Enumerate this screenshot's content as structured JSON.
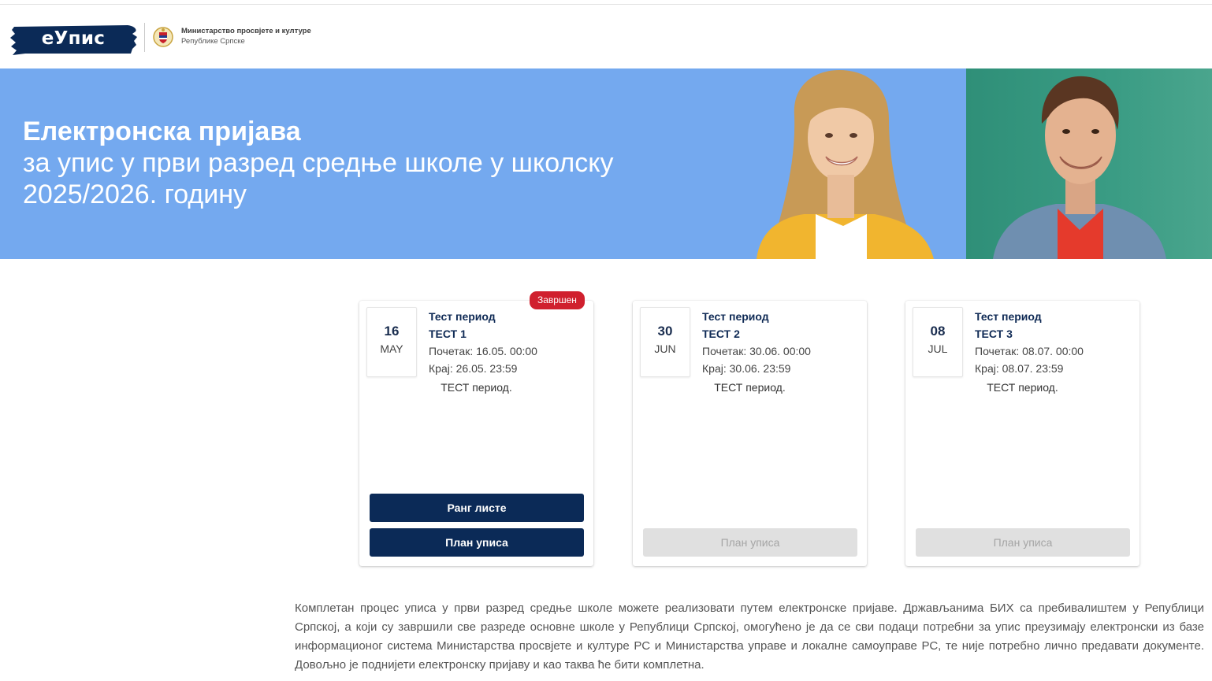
{
  "header": {
    "logo_text": "еУпис",
    "ministry_line1": "Министарство просвјете и културе",
    "ministry_line2": "Републике Српске"
  },
  "hero": {
    "title_line1": "Електронска пријава",
    "title_line2": "за упис у први разред средње школе у школску",
    "title_line3": "2025/2026. годину"
  },
  "periods": [
    {
      "day": "16",
      "month": "MAY",
      "name": "Тест период",
      "code": "ТЕСТ 1",
      "start": "Почетак: 16.05. 00:00",
      "end": "Крај: 26.05. 23:59",
      "description": "ТЕСТ период.",
      "badge": "Завршен",
      "rank_button": "Ранг листе",
      "plan_button": "План уписа"
    },
    {
      "day": "30",
      "month": "JUN",
      "name": "Тест период",
      "code": "ТЕСТ 2",
      "start": "Почетак: 30.06. 00:00",
      "end": "Крај: 30.06. 23:59",
      "description": "ТЕСТ период.",
      "plan_button": "План уписа"
    },
    {
      "day": "08",
      "month": "JUL",
      "name": "Тест период",
      "code": "ТЕСТ 3",
      "start": "Почетак: 08.07. 00:00",
      "end": "Крај: 08.07. 23:59",
      "description": "ТЕСТ период.",
      "plan_button": "План уписа"
    }
  ],
  "intro_text": "Комплетан процес уписа у први разред средње школе можете реализовати путем електронске пријаве. Држављанима БИХ са пребивалиштем у Републици Српској, а који су завршили све разреде основне школе у Републици Српској, омогућено је да се сви подаци потребни за упис преузимају електронски из базе информационог система Министарства просвјете и културе РС и Министарства управе и локалне самоуправе РС, те није потребно лично предавати документе. Довољно је поднијети електронску пријаву и као таква ће бити комплетна.",
  "colors": {
    "brand_navy": "#0b2a57",
    "hero_blue": "#74a9ef",
    "hero_green": "#2f8f78",
    "badge_red": "#d0202e",
    "disabled_gray": "#e0e0e0"
  }
}
